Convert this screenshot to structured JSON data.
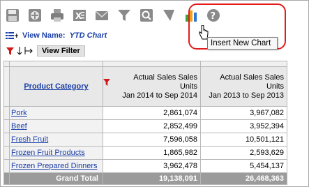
{
  "toolbar": {
    "icons": [
      "save-icon",
      "add-icon",
      "print-icon",
      "excel-export-icon",
      "email-icon",
      "filter-icon",
      "search-report-icon",
      "flag-icon",
      "chart-icon",
      "help-icon"
    ]
  },
  "tooltip": "Insert New Chart",
  "view": {
    "label": "View Name:",
    "value": "YTD Chart"
  },
  "filter_button": "View Filter",
  "table": {
    "header_category": "Product Category",
    "header_col1_line1": "Actual Sales Sales Units",
    "header_col1_line2": "Jan 2014 to Sep 2014",
    "header_col2_line1": "Actual Sales Sales Units",
    "header_col2_line2": "Jan 2013 to Sep 2013",
    "rows": [
      {
        "category": "Pork",
        "col1": "2,861,074",
        "col2": "3,967,082"
      },
      {
        "category": "Beef",
        "col1": "2,852,499",
        "col2": "3,952,394"
      },
      {
        "category": "Fresh Fruit",
        "col1": "7,596,058",
        "col2": "10,501,121"
      },
      {
        "category": "Frozen Fruit Products",
        "col1": "1,865,982",
        "col2": "2,593,629"
      },
      {
        "category": "Frozen Prepared Dinners",
        "col1": "3,962,478",
        "col2": "5,454,137"
      }
    ],
    "total_label": "Grand Total",
    "total_col1": "19,138,091",
    "total_col2": "26,468,363"
  },
  "colors": {
    "link_blue": "#1a3ea8",
    "highlight_red": "#e31b1b",
    "total_bg": "#9b9b9b"
  }
}
